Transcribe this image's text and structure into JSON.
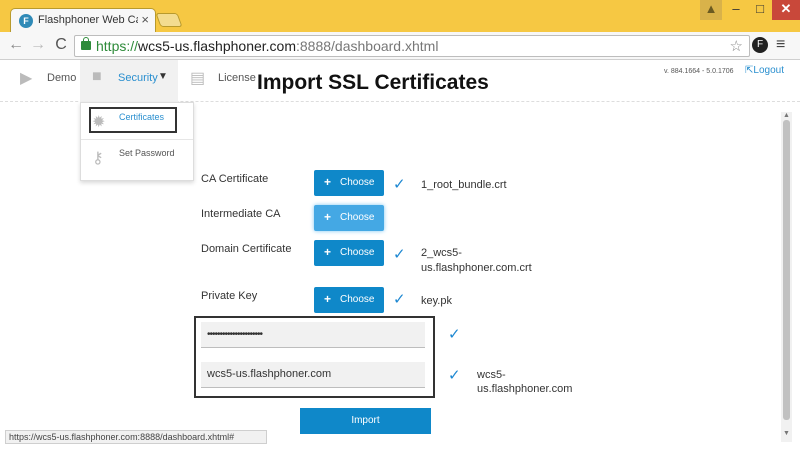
{
  "browser": {
    "tab_title": "Flashphoner Web Call Ser",
    "tab_close": "×",
    "favicon": "F",
    "url": {
      "scheme": "https://",
      "host": "wcs5-us.flashphoner.com",
      "path": ":8888/dashboard.xhtml"
    },
    "icons": {
      "back": "←",
      "forward": "→",
      "reload": "C",
      "star": "☆",
      "menu": "≡",
      "user": "▲",
      "minimize": "–",
      "maximize": "□",
      "close": "✕"
    },
    "status_url": "https://wcs5-us.flashphoner.com:8888/dashboard.xhtml#"
  },
  "nav": {
    "demo_label": "Demo",
    "security_label": "Security",
    "license_label": "License",
    "version": "v. 884.1664 - 5.0.1706",
    "logout_label": "Logout"
  },
  "dropdown": {
    "items": [
      {
        "label": "Certificates"
      },
      {
        "label": "Set Password"
      }
    ]
  },
  "main": {
    "heading": "Import SSL Certificates",
    "rows": [
      {
        "label": "CA Certificate",
        "button": "Choose",
        "checked": true,
        "file": "1_root_bundle.crt"
      },
      {
        "label": "Intermediate CA",
        "button": "Choose",
        "checked": false,
        "file": ""
      },
      {
        "label": "Domain Certificate",
        "button": "Choose",
        "checked": true,
        "file_line1": "2_wcs5-",
        "file_line2": "us.flashphoner.com.crt"
      },
      {
        "label": "Private Key",
        "button": "Choose",
        "checked": true,
        "file": "key.pk"
      }
    ],
    "password_value": "••••••••••••••••••••••",
    "hostname_value": "wcs5-us.flashphoner.com",
    "hostname_confirm_line1": "wcs5-",
    "hostname_confirm_line2": "us.flashphoner.com",
    "check_symbol": "✓",
    "plus_symbol": "+",
    "import_button": "Import"
  },
  "colors": {
    "accent": "#0f88c9",
    "link": "#2a8fcf",
    "window_frame": "#f6c843"
  }
}
